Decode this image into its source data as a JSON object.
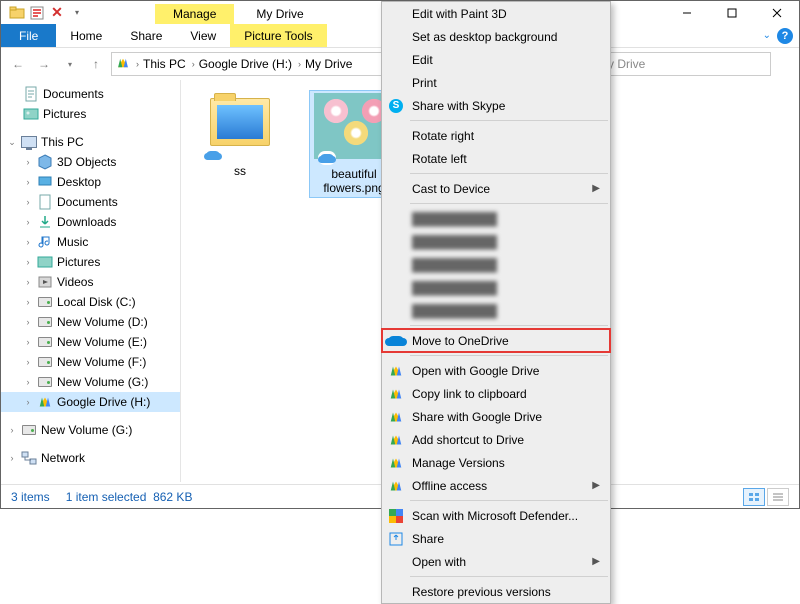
{
  "title": "My Drive",
  "contextual_tab": "Manage",
  "ribbon": {
    "file": "File",
    "home": "Home",
    "share": "Share",
    "view": "View",
    "picture_tools": "Picture Tools"
  },
  "breadcrumbs": [
    "This PC",
    "Google Drive (H:)",
    "My Drive"
  ],
  "search_placeholder": "My Drive",
  "quick_access": [
    {
      "label": "Documents"
    },
    {
      "label": "Pictures"
    }
  ],
  "this_pc_label": "This PC",
  "this_pc_children": [
    "3D Objects",
    "Desktop",
    "Documents",
    "Downloads",
    "Music",
    "Pictures",
    "Videos",
    "Local Disk (C:)",
    "New Volume (D:)",
    "New Volume (E:)",
    "New Volume (F:)",
    "New Volume (G:)",
    "Google Drive (H:)"
  ],
  "extra_tree": [
    "New Volume (G:)",
    "Network"
  ],
  "content_items": [
    {
      "name": "ss",
      "type": "folder"
    },
    {
      "name": "beautiful flowers.png",
      "type": "image",
      "selected": true
    }
  ],
  "status": {
    "count": "3 items",
    "selection": "1 item selected",
    "size": "862 KB"
  },
  "context_menu": {
    "groups": [
      [
        {
          "label": "Edit with Paint 3D"
        },
        {
          "label": "Set as desktop background"
        },
        {
          "label": "Edit"
        },
        {
          "label": "Print"
        },
        {
          "label": "Share with Skype",
          "icon": "skype"
        }
      ],
      [
        {
          "label": "Rotate right"
        },
        {
          "label": "Rotate left"
        }
      ],
      [
        {
          "label": "Cast to Device",
          "submenu": true
        }
      ],
      [
        {
          "label": "blurred",
          "blurred": true
        },
        {
          "label": "blurred",
          "blurred": true
        },
        {
          "label": "blurred",
          "blurred": true
        },
        {
          "label": "blurred",
          "blurred": true
        },
        {
          "label": "blurred",
          "blurred": true
        }
      ],
      [
        {
          "label": "Move to OneDrive",
          "icon": "onedrive",
          "highlight": true
        }
      ],
      [
        {
          "label": "Open with Google Drive",
          "icon": "gdrive"
        },
        {
          "label": "Copy link to clipboard",
          "icon": "gdrive"
        },
        {
          "label": "Share with Google Drive",
          "icon": "gdrive"
        },
        {
          "label": "Add shortcut to Drive",
          "icon": "gdrive"
        },
        {
          "label": "Manage Versions",
          "icon": "gdrive"
        },
        {
          "label": "Offline access",
          "icon": "gdrive",
          "submenu": true
        }
      ],
      [
        {
          "label": "Scan with Microsoft Defender...",
          "icon": "defender"
        },
        {
          "label": "Share",
          "icon": "share"
        },
        {
          "label": "Open with",
          "submenu": true
        }
      ],
      [
        {
          "label": "Restore previous versions"
        }
      ]
    ]
  }
}
